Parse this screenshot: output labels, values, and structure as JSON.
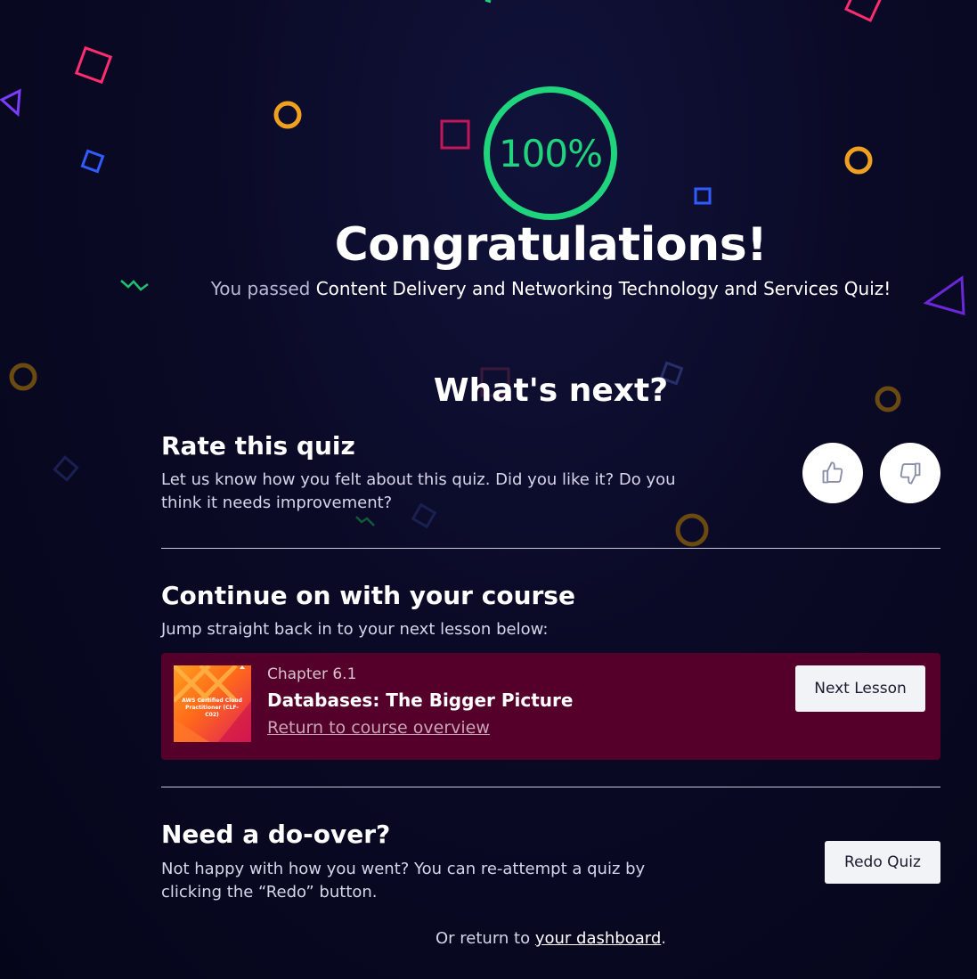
{
  "score": {
    "value_text": "100%",
    "color": "#1fd47c"
  },
  "header": {
    "title": "Congratulations!",
    "passed_prefix": "You passed ",
    "quiz_name": "Content Delivery and Networking Technology and Services Quiz!"
  },
  "whats_next": {
    "heading": "What's next?"
  },
  "rate": {
    "title": "Rate this quiz",
    "description_line1": "Let us know how you felt about this quiz. Did you like it? Do you",
    "description_line2": "think it needs improvement?",
    "thumbs_up_icon": "thumbs-up-icon",
    "thumbs_down_icon": "thumbs-down-icon"
  },
  "course": {
    "title": "Continue on with your course",
    "description": "Jump straight back in to your next lesson below:",
    "lesson": {
      "chapter": "Chapter 6.1",
      "title": "Databases: The Bigger Picture",
      "overview_link": "Return to course overview",
      "thumbnail_caption": "AWS Certified Cloud Practitioner (CLF-C02)",
      "card_color": "#55002a"
    },
    "next_button": "Next Lesson"
  },
  "redo": {
    "title": "Need a do-over?",
    "description_line1": "Not happy with how you went? You can re-attempt a quiz by",
    "description_line2": "clicking the “Redo” button.",
    "button": "Redo Quiz"
  },
  "footer": {
    "prefix": "Or return to ",
    "link": "your dashboard",
    "suffix": "."
  }
}
